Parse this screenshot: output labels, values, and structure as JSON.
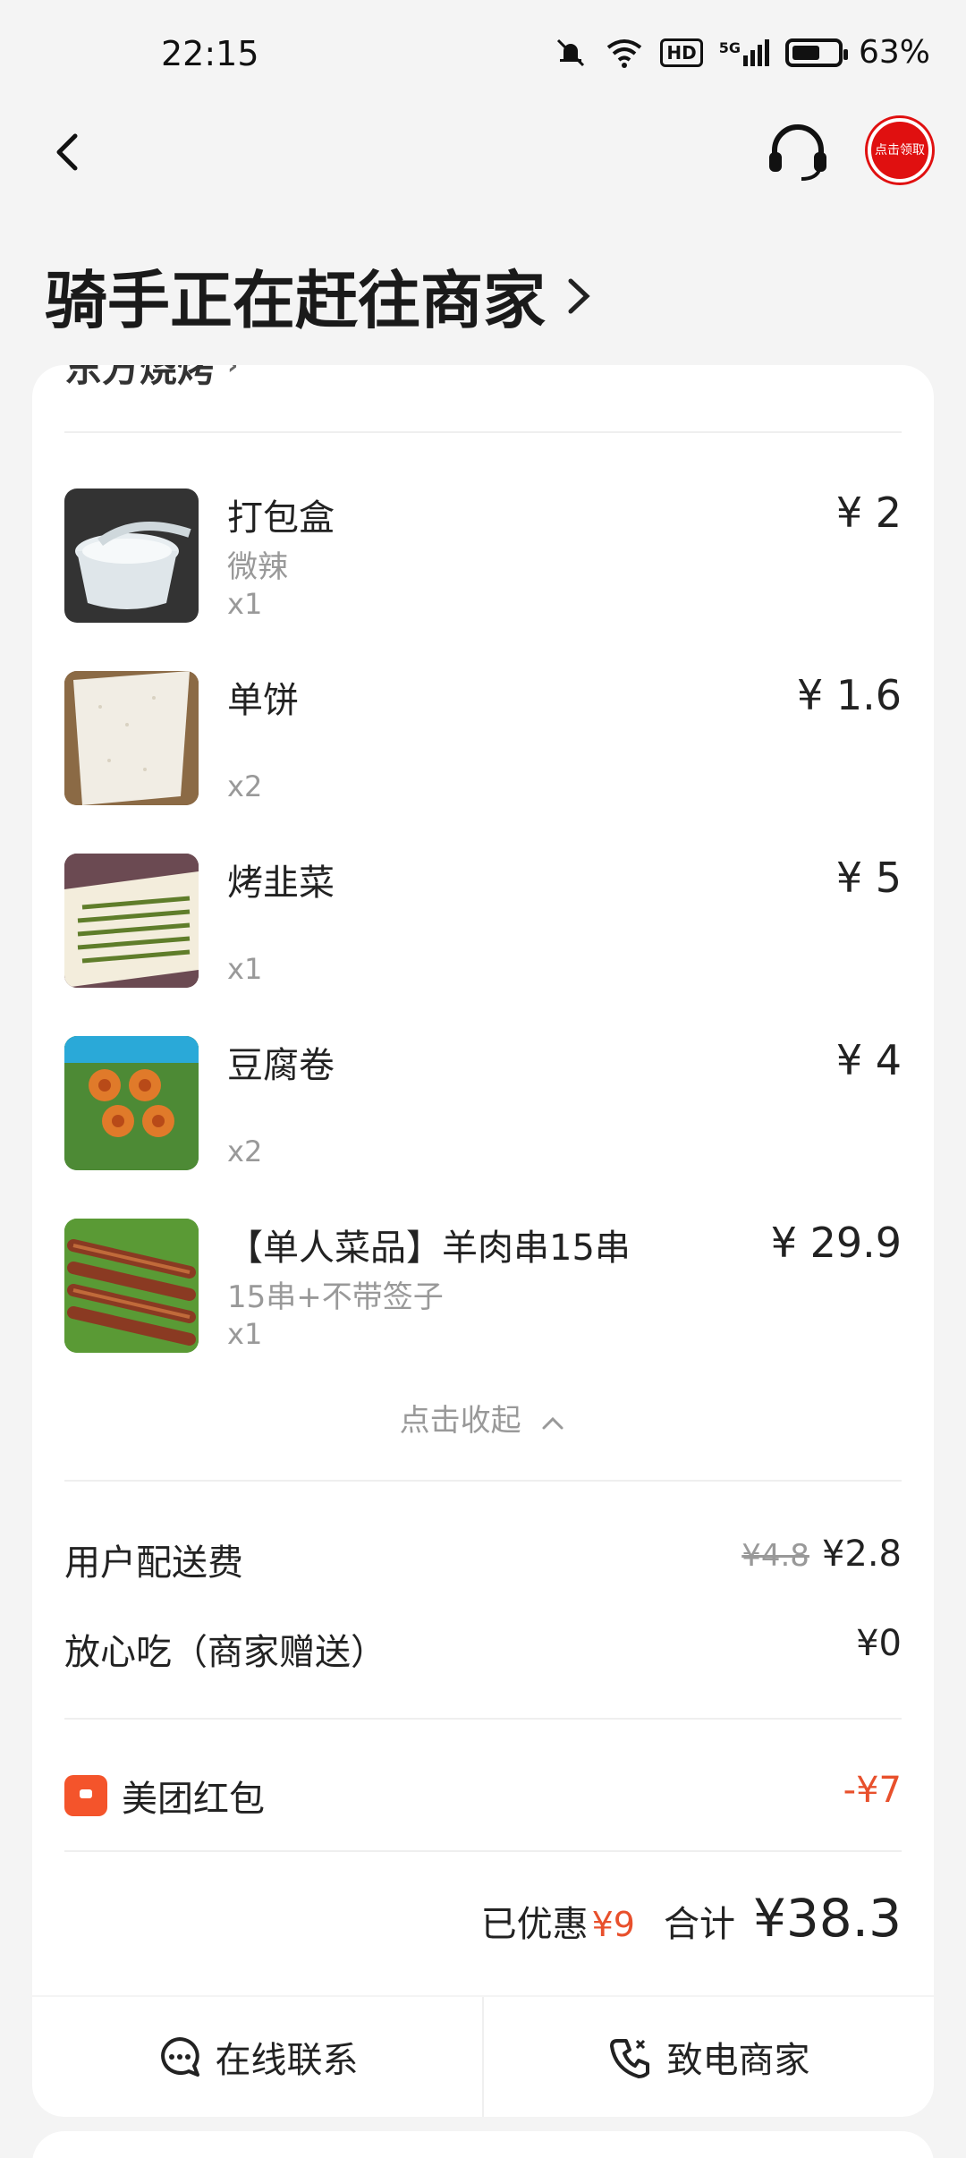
{
  "status_bar": {
    "time": "22:15",
    "hd": "HD",
    "network": "5G",
    "battery": "63%",
    "battery_level": 0.63
  },
  "header": {
    "coupon_label": "点击领取"
  },
  "title": "骑手正在赶往商家",
  "shop_name": "东方烧烤",
  "items": [
    {
      "name": "打包盒",
      "spec": "微辣",
      "qty": "x1",
      "price": "¥ 2"
    },
    {
      "name": "单饼",
      "spec": "",
      "qty": "x2",
      "price": "¥ 1.6"
    },
    {
      "name": "烤韭菜",
      "spec": "",
      "qty": "x1",
      "price": "¥ 5"
    },
    {
      "name": "豆腐卷",
      "spec": "",
      "qty": "x2",
      "price": "¥ 4"
    },
    {
      "name": "【单人菜品】羊肉串15串",
      "spec": "15串+不带签子",
      "qty": "x1",
      "price": "¥ 29.9"
    }
  ],
  "collapse_label": "点击收起",
  "fees": {
    "delivery_label": "用户配送费",
    "delivery_original": "¥4.8",
    "delivery_price": "¥2.8",
    "safe_label": "放心吃（商家赠送）",
    "safe_price": "¥0"
  },
  "redpacket": {
    "label": "美团红包",
    "value": "-¥7"
  },
  "summary": {
    "discount_label": "已优惠",
    "discount_value": "¥9",
    "total_label": "合计",
    "total_value": "¥38.3"
  },
  "actions": {
    "chat_label": "在线联系",
    "call_label": "致电商家"
  }
}
